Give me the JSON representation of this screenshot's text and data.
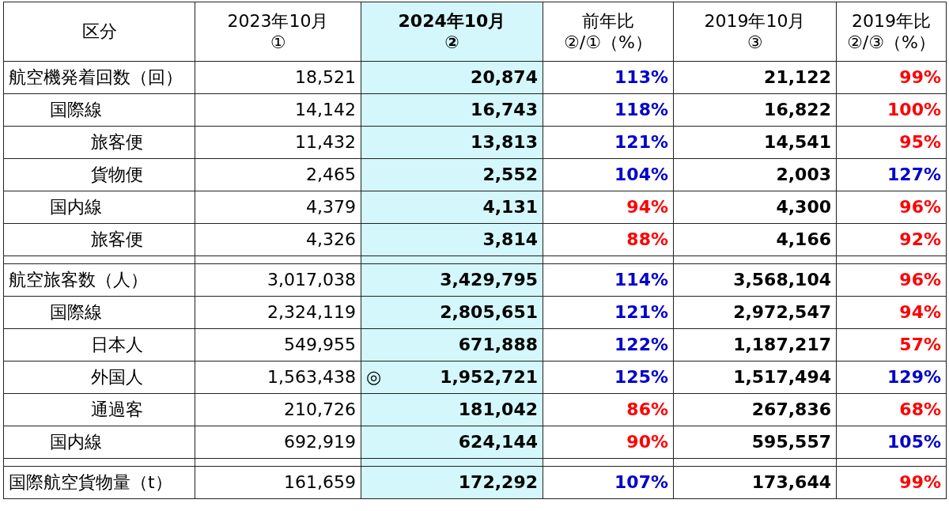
{
  "columns": [
    {
      "lines": [
        "区分"
      ],
      "highlight": false,
      "bold_values": false
    },
    {
      "lines": [
        "2023年10月",
        "①"
      ],
      "highlight": false,
      "bold_values": false
    },
    {
      "lines": [
        "2024年10月",
        "②"
      ],
      "highlight": true,
      "bold_values": true
    },
    {
      "lines": [
        "前年比",
        "②/①（%）"
      ],
      "highlight": false,
      "bold_values": true
    },
    {
      "lines": [
        "2019年10月",
        "③"
      ],
      "highlight": false,
      "bold_values": true
    },
    {
      "lines": [
        "2019年比",
        "②/③（%）"
      ],
      "highlight": false,
      "bold_values": true
    }
  ],
  "sections": [
    {
      "label": "航空機発着回数（回）",
      "values": [
        {
          "text": "18,521"
        },
        {
          "text": "20,874"
        },
        {
          "text": "113%",
          "color": "#0000cc"
        },
        {
          "text": "21,122"
        },
        {
          "text": "99%",
          "color": "#ff0000"
        }
      ],
      "children": [
        {
          "label": "国際線",
          "values": [
            {
              "text": "14,142"
            },
            {
              "text": "16,743"
            },
            {
              "text": "118%",
              "color": "#0000cc"
            },
            {
              "text": "16,822"
            },
            {
              "text": "100%",
              "color": "#ff0000"
            }
          ],
          "children": [
            {
              "label": "旅客便",
              "values": [
                {
                  "text": "11,432"
                },
                {
                  "text": "13,813"
                },
                {
                  "text": "121%",
                  "color": "#0000cc"
                },
                {
                  "text": "14,541"
                },
                {
                  "text": "95%",
                  "color": "#ff0000"
                }
              ]
            },
            {
              "label": "貨物便",
              "values": [
                {
                  "text": "2,465"
                },
                {
                  "text": "2,552"
                },
                {
                  "text": "104%",
                  "color": "#0000cc"
                },
                {
                  "text": "2,003"
                },
                {
                  "text": "127%",
                  "color": "#0000cc"
                }
              ]
            }
          ]
        },
        {
          "label": "国内線",
          "values": [
            {
              "text": "4,379"
            },
            {
              "text": "4,131"
            },
            {
              "text": "94%",
              "color": "#ff0000"
            },
            {
              "text": "4,300"
            },
            {
              "text": "96%",
              "color": "#ff0000"
            }
          ],
          "children": [
            {
              "label": "旅客便",
              "values": [
                {
                  "text": "4,326"
                },
                {
                  "text": "3,814"
                },
                {
                  "text": "88%",
                  "color": "#ff0000"
                },
                {
                  "text": "4,166"
                },
                {
                  "text": "92%",
                  "color": "#ff0000"
                }
              ]
            }
          ]
        }
      ]
    },
    {
      "label": "航空旅客数（人）",
      "values": [
        {
          "text": "3,017,038"
        },
        {
          "text": "3,429,795"
        },
        {
          "text": "114%",
          "color": "#0000cc"
        },
        {
          "text": "3,568,104"
        },
        {
          "text": "96%",
          "color": "#ff0000"
        }
      ],
      "children": [
        {
          "label": "国際線",
          "values": [
            {
              "text": "2,324,119"
            },
            {
              "text": "2,805,651"
            },
            {
              "text": "121%",
              "color": "#0000cc"
            },
            {
              "text": "2,972,547"
            },
            {
              "text": "94%",
              "color": "#ff0000"
            }
          ],
          "children": [
            {
              "label": "日本人",
              "values": [
                {
                  "text": "549,955"
                },
                {
                  "text": "671,888"
                },
                {
                  "text": "122%",
                  "color": "#0000cc"
                },
                {
                  "text": "1,187,217"
                },
                {
                  "text": "57%",
                  "color": "#ff0000"
                }
              ]
            },
            {
              "label": "外国人",
              "values": [
                {
                  "text": "1,563,438"
                },
                {
                  "text": "1,952,721",
                  "mark": "◎"
                },
                {
                  "text": "125%",
                  "color": "#0000cc"
                },
                {
                  "text": "1,517,494"
                },
                {
                  "text": "129%",
                  "color": "#0000cc"
                }
              ]
            },
            {
              "label": "通過客",
              "values": [
                {
                  "text": "210,726"
                },
                {
                  "text": "181,042"
                },
                {
                  "text": "86%",
                  "color": "#ff0000"
                },
                {
                  "text": "267,836"
                },
                {
                  "text": "68%",
                  "color": "#ff0000"
                }
              ]
            }
          ]
        },
        {
          "label": "国内線",
          "values": [
            {
              "text": "692,919"
            },
            {
              "text": "624,144"
            },
            {
              "text": "90%",
              "color": "#ff0000"
            },
            {
              "text": "595,557"
            },
            {
              "text": "105%",
              "color": "#0000cc"
            }
          ]
        }
      ]
    },
    {
      "label": "国際航空貨物量（t）",
      "values": [
        {
          "text": "161,659"
        },
        {
          "text": "172,292"
        },
        {
          "text": "107%",
          "color": "#0000cc"
        },
        {
          "text": "173,644"
        },
        {
          "text": "99%",
          "color": "#ff0000"
        }
      ]
    }
  ]
}
